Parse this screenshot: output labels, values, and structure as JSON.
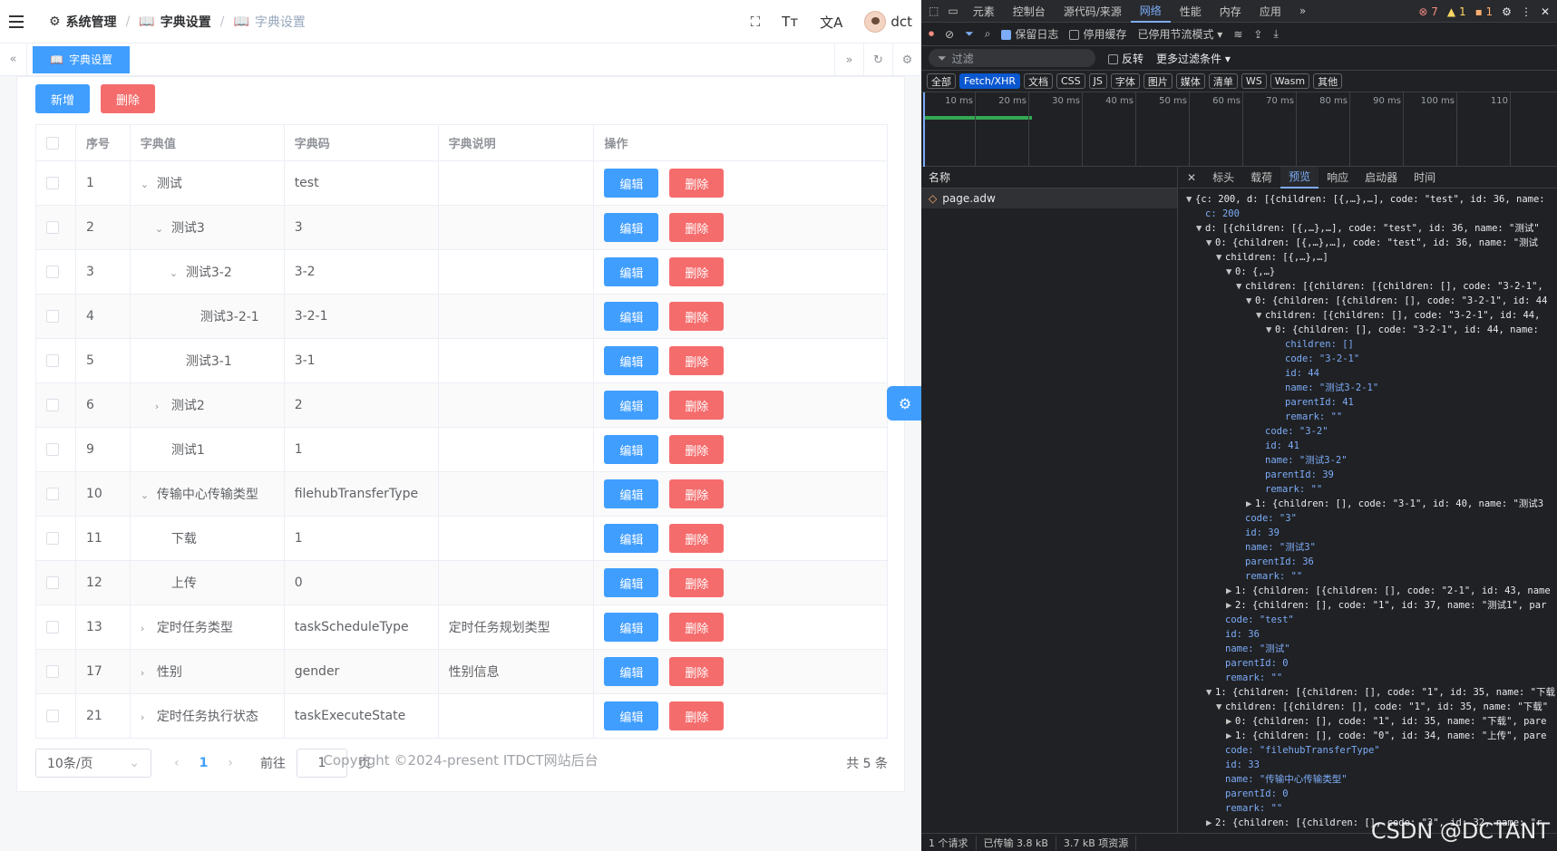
{
  "breadcrumb": {
    "items": [
      "系统管理",
      "字典设置",
      "字典设置"
    ]
  },
  "user": {
    "name": "dct"
  },
  "tags": {
    "active": "字典设置"
  },
  "toolbar": {
    "add_label": "新增",
    "delete_label": "删除"
  },
  "table": {
    "headers": [
      "序号",
      "字典值",
      "字典码",
      "字典说明",
      "操作"
    ],
    "edit_label": "编辑",
    "delete_label": "删除",
    "rows": [
      {
        "no": "1",
        "value": "测试",
        "code": "test",
        "desc": "",
        "indent": 0,
        "arrow": "down"
      },
      {
        "no": "2",
        "value": "测试3",
        "code": "3",
        "desc": "",
        "indent": 1,
        "arrow": "down"
      },
      {
        "no": "3",
        "value": "测试3-2",
        "code": "3-2",
        "desc": "",
        "indent": 2,
        "arrow": "down"
      },
      {
        "no": "4",
        "value": "测试3-2-1",
        "code": "3-2-1",
        "desc": "",
        "indent": 3,
        "arrow": ""
      },
      {
        "no": "5",
        "value": "测试3-1",
        "code": "3-1",
        "desc": "",
        "indent": 2,
        "arrow": ""
      },
      {
        "no": "6",
        "value": "测试2",
        "code": "2",
        "desc": "",
        "indent": 1,
        "arrow": "right"
      },
      {
        "no": "9",
        "value": "测试1",
        "code": "1",
        "desc": "",
        "indent": 1,
        "arrow": ""
      },
      {
        "no": "10",
        "value": "传输中心传输类型",
        "code": "filehubTransferType",
        "desc": "",
        "indent": 0,
        "arrow": "down"
      },
      {
        "no": "11",
        "value": "下载",
        "code": "1",
        "desc": "",
        "indent": 1,
        "arrow": ""
      },
      {
        "no": "12",
        "value": "上传",
        "code": "0",
        "desc": "",
        "indent": 1,
        "arrow": ""
      },
      {
        "no": "13",
        "value": "定时任务类型",
        "code": "taskScheduleType",
        "desc": "定时任务规划类型",
        "indent": 0,
        "arrow": "right"
      },
      {
        "no": "17",
        "value": "性别",
        "code": "gender",
        "desc": "性别信息",
        "indent": 0,
        "arrow": "right"
      },
      {
        "no": "21",
        "value": "定时任务执行状态",
        "code": "taskExecuteState",
        "desc": "",
        "indent": 0,
        "arrow": "right"
      }
    ]
  },
  "pagination": {
    "size": "10条/页",
    "current": "1",
    "goto_prefix": "前往",
    "goto_value": "1",
    "goto_suffix": "页",
    "total": "共 5 条"
  },
  "footer": {
    "copyright": "Copyright ©2024-present ITDCT网站后台"
  },
  "devtools": {
    "tabs": [
      "元素",
      "控制台",
      "源代码/来源",
      "网络",
      "性能",
      "内存",
      "应用"
    ],
    "active_tab": "网络",
    "counts": {
      "errors": "7",
      "warnings": "1",
      "info": "1"
    },
    "options": {
      "preserve_log": "保留日志",
      "disable_cache": "停用缓存",
      "throttle": "已停用节流模式"
    },
    "filter": {
      "placeholder": "过滤",
      "invert": "反转",
      "more": "更多过滤条件"
    },
    "types": [
      "全部",
      "Fetch/XHR",
      "文档",
      "CSS",
      "JS",
      "字体",
      "图片",
      "媒体",
      "清单",
      "WS",
      "Wasm",
      "其他"
    ],
    "active_type": "Fetch/XHR",
    "timeline_ticks": [
      "10 ms",
      "20 ms",
      "30 ms",
      "40 ms",
      "50 ms",
      "60 ms",
      "70 ms",
      "80 ms",
      "90 ms",
      "100 ms",
      "110"
    ],
    "name_header": "名称",
    "request": "page.adw",
    "detail_tabs": [
      "标头",
      "载荷",
      "预览",
      "响应",
      "启动器",
      "时间"
    ],
    "active_detail_tab": "预览",
    "footer": [
      "1 个请求",
      "已传输 3.8 kB",
      "3.7 kB 项资源"
    ],
    "json_lines": [
      {
        "i": 0,
        "t": "▼",
        "text": "{c: 200, d: [{children: [{,…},…], code: \"test\", id: 36, name: "
      },
      {
        "i": 1,
        "t": "",
        "text": "c: 200"
      },
      {
        "i": 1,
        "t": "▼",
        "text": "d: [{children: [{,…},…], code: \"test\", id: 36, name: \"测试\""
      },
      {
        "i": 2,
        "t": "▼",
        "text": "0: {children: [{,…},…], code: \"test\", id: 36, name: \"测试"
      },
      {
        "i": 3,
        "t": "▼",
        "text": "children: [{,…},…]"
      },
      {
        "i": 4,
        "t": "▼",
        "text": "0: {,…}"
      },
      {
        "i": 5,
        "t": "▼",
        "text": "children: [{children: [{children: [], code: \"3-2-1\","
      },
      {
        "i": 6,
        "t": "▼",
        "text": "0: {children: [{children: [], code: \"3-2-1\", id: 44"
      },
      {
        "i": 7,
        "t": "▼",
        "text": "children: [{children: [], code: \"3-2-1\", id: 44, "
      },
      {
        "i": 8,
        "t": "▼",
        "text": "0: {children: [], code: \"3-2-1\", id: 44, name: "
      },
      {
        "i": 9,
        "t": "",
        "text": "children: []"
      },
      {
        "i": 9,
        "t": "",
        "text": "code: \"3-2-1\""
      },
      {
        "i": 9,
        "t": "",
        "text": "id: 44"
      },
      {
        "i": 9,
        "t": "",
        "text": "name: \"测试3-2-1\""
      },
      {
        "i": 9,
        "t": "",
        "text": "parentId: 41"
      },
      {
        "i": 9,
        "t": "",
        "text": "remark: \"\""
      },
      {
        "i": 7,
        "t": "",
        "text": "code: \"3-2\""
      },
      {
        "i": 7,
        "t": "",
        "text": "id: 41"
      },
      {
        "i": 7,
        "t": "",
        "text": "name: \"测试3-2\""
      },
      {
        "i": 7,
        "t": "",
        "text": "parentId: 39"
      },
      {
        "i": 7,
        "t": "",
        "text": "remark: \"\""
      },
      {
        "i": 6,
        "t": "▶",
        "text": "1: {children: [], code: \"3-1\", id: 40, name: \"测试3"
      },
      {
        "i": 5,
        "t": "",
        "text": "code: \"3\""
      },
      {
        "i": 5,
        "t": "",
        "text": "id: 39"
      },
      {
        "i": 5,
        "t": "",
        "text": "name: \"测试3\""
      },
      {
        "i": 5,
        "t": "",
        "text": "parentId: 36"
      },
      {
        "i": 5,
        "t": "",
        "text": "remark: \"\""
      },
      {
        "i": 4,
        "t": "▶",
        "text": "1: {children: [{children: [], code: \"2-1\", id: 43, name"
      },
      {
        "i": 4,
        "t": "▶",
        "text": "2: {children: [], code: \"1\", id: 37, name: \"测试1\", par"
      },
      {
        "i": 3,
        "t": "",
        "text": "code: \"test\""
      },
      {
        "i": 3,
        "t": "",
        "text": "id: 36"
      },
      {
        "i": 3,
        "t": "",
        "text": "name: \"测试\""
      },
      {
        "i": 3,
        "t": "",
        "text": "parentId: 0"
      },
      {
        "i": 3,
        "t": "",
        "text": "remark: \"\""
      },
      {
        "i": 2,
        "t": "▼",
        "text": "1: {children: [{children: [], code: \"1\", id: 35, name: \"下载"
      },
      {
        "i": 3,
        "t": "▼",
        "text": "children: [{children: [], code: \"1\", id: 35, name: \"下载\""
      },
      {
        "i": 4,
        "t": "▶",
        "text": "0: {children: [], code: \"1\", id: 35, name: \"下载\", pare"
      },
      {
        "i": 4,
        "t": "▶",
        "text": "1: {children: [], code: \"0\", id: 34, name: \"上传\", pare"
      },
      {
        "i": 3,
        "t": "",
        "text": "code: \"filehubTransferType\""
      },
      {
        "i": 3,
        "t": "",
        "text": "id: 33"
      },
      {
        "i": 3,
        "t": "",
        "text": "name: \"传输中心传输类型\""
      },
      {
        "i": 3,
        "t": "",
        "text": "parentId: 0"
      },
      {
        "i": 3,
        "t": "",
        "text": "remark: \"\""
      },
      {
        "i": 2,
        "t": "▶",
        "text": "2: {children: [{children: [], code: \"3\", id: 32, name: \"r"
      }
    ],
    "watermark": "CSDN @DCTANT"
  }
}
